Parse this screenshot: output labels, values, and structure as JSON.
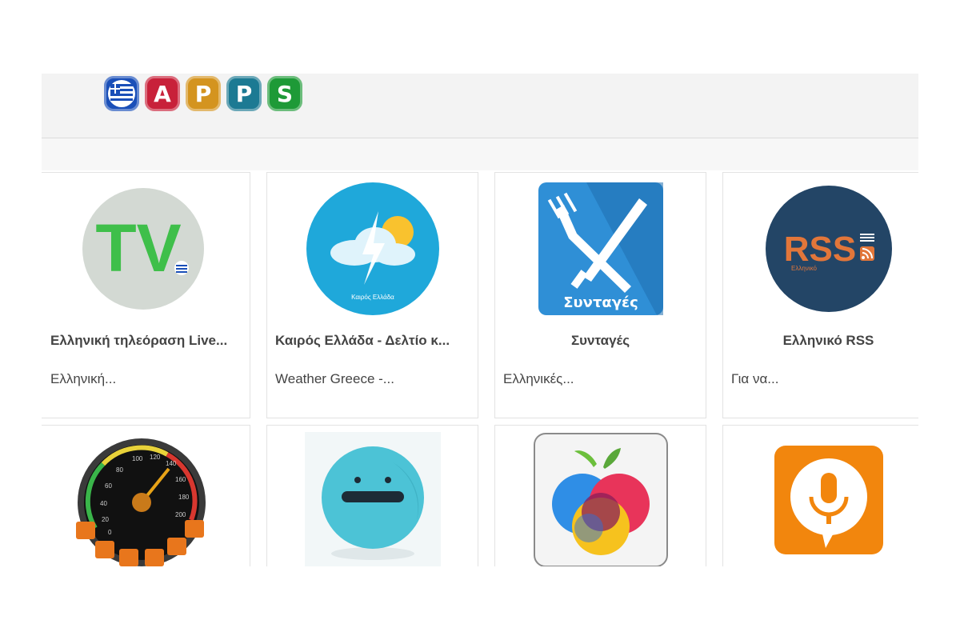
{
  "header": {
    "logo_letters": [
      "A",
      "P",
      "P",
      "S"
    ]
  },
  "apps_row1": [
    {
      "title": "Ελληνική τηλεόραση Live...",
      "desc": "Ελληνική...",
      "icon": "tv-icon"
    },
    {
      "title": "Καιρός Ελλάδα - Δελτίο κ...",
      "desc": "Weather Greece -...",
      "icon": "weather-icon",
      "icon_caption": "Καιρός Ελλάδα"
    },
    {
      "title": "Συνταγές",
      "desc": "Ελληνικές...",
      "icon": "fork-knife-icon",
      "icon_caption": "Συνταγές"
    },
    {
      "title": "Ελληνικό RSS",
      "desc": "Για να...",
      "icon": "rss-icon",
      "icon_caption": "Ελληνικό",
      "icon_text": "RSS"
    }
  ],
  "apps_row2": [
    {
      "icon": "speedometer-icon",
      "gauge_ticks": [
        "20",
        "40",
        "60",
        "80",
        "100",
        "120",
        "140",
        "160",
        "180",
        "200",
        "0"
      ]
    },
    {
      "icon": "smiley-icon"
    },
    {
      "icon": "apple-icon"
    },
    {
      "icon": "microphone-icon"
    }
  ],
  "icons": {
    "tv": {
      "text": "TV"
    }
  },
  "colors": {
    "tv_green": "#3fbf4a",
    "weather_blue": "#1fa8da",
    "recipes_blue": "#2f8fd6",
    "rss_navy": "#234566",
    "rss_orange": "#e2763a",
    "smiley": "#4cc3d6",
    "mic_orange": "#f2860d"
  }
}
